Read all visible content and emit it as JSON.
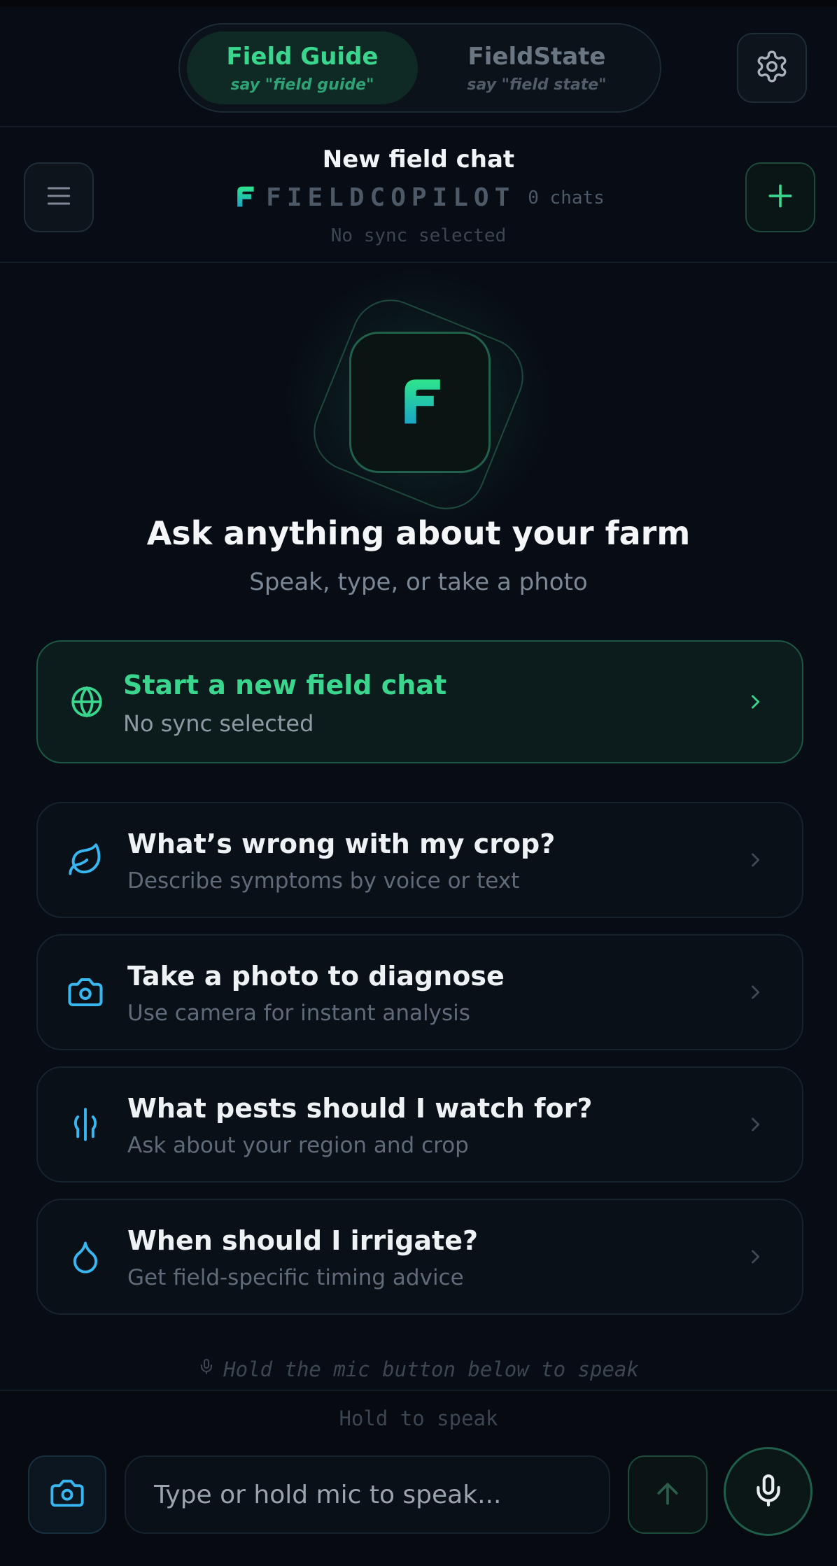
{
  "modes": {
    "active": {
      "title": "Field Guide",
      "sub": "say \"field guide\""
    },
    "inactive": {
      "title": "FieldState",
      "sub": "say \"field state\""
    }
  },
  "header": {
    "chat_title": "New field chat",
    "brand": "FIELDCOPILOT",
    "chat_count": "0 chats",
    "sync": "No sync selected"
  },
  "hero": {
    "title": "Ask anything about your farm",
    "subtitle": "Speak, type, or take a photo"
  },
  "primary_card": {
    "title": "Start a new field chat",
    "subtitle": "No sync selected",
    "icon": "globe-icon"
  },
  "prompts": [
    {
      "title": "What’s wrong with my crop?",
      "subtitle": "Describe symptoms by voice or text",
      "icon": "leaf-icon"
    },
    {
      "title": "Take a photo to diagnose",
      "subtitle": "Use camera for instant analysis",
      "icon": "camera-icon"
    },
    {
      "title": "What pests should I watch for?",
      "subtitle": "Ask about your region and crop",
      "icon": "wheat-icon"
    },
    {
      "title": "When should I irrigate?",
      "subtitle": "Get field-specific timing advice",
      "icon": "droplet-icon"
    }
  ],
  "hint": "Hold the mic button below to speak",
  "bottom": {
    "hold_label": "Hold to speak",
    "input_placeholder": "Type or hold mic to speak..."
  },
  "colors": {
    "accent_green": "#3bd68e",
    "icon_blue": "#38b6f0",
    "background": "#080c14"
  }
}
